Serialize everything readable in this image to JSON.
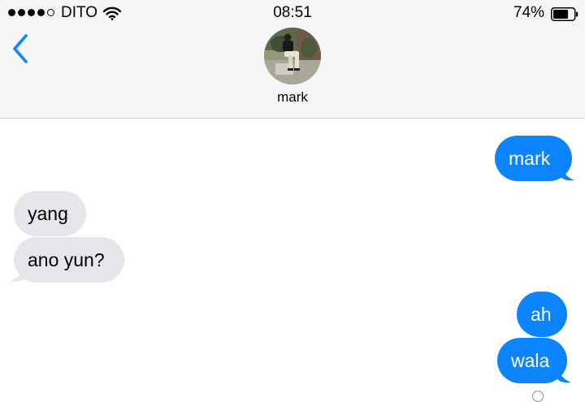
{
  "status_bar": {
    "carrier": "DITO",
    "time": "08:51",
    "battery_percent": "74%",
    "battery_level": 0.74,
    "signal_bars_filled": 4,
    "signal_bars_total": 5
  },
  "header": {
    "contact_name": "mark"
  },
  "messages": [
    {
      "direction": "sent",
      "text": "mark"
    },
    {
      "direction": "received",
      "text": "yang"
    },
    {
      "direction": "received",
      "text": "ano yun?"
    },
    {
      "direction": "sent",
      "text": "ah"
    },
    {
      "direction": "sent",
      "text": "wala"
    }
  ],
  "colors": {
    "sent_bubble": "#0b84fe",
    "received_bubble": "#e5e5ea",
    "accent": "#0b84fe",
    "header_bg": "#f6f6f8"
  },
  "icons": {
    "back": "chevron-left-icon",
    "wifi": "wifi-icon",
    "battery": "battery-icon"
  }
}
